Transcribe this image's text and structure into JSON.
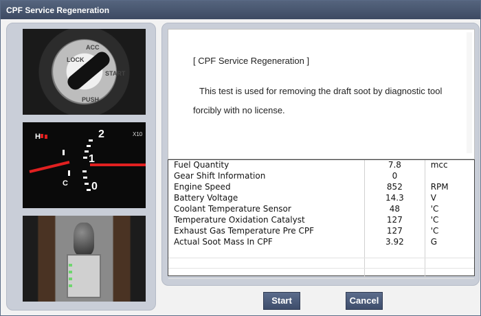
{
  "window": {
    "title": "CPF Service Regeneration"
  },
  "images": {
    "ignition": {
      "labels": [
        "LOCK",
        "ACC",
        "START",
        "PUSH"
      ]
    },
    "gauge": {
      "labels": [
        "H",
        "C",
        "2",
        "1",
        "0",
        "X10"
      ]
    }
  },
  "description": {
    "title": "[ CPF Service Regeneration ]",
    "line1": "This test is used for removing the draft soot by diagnostic tool",
    "line2": "forcibly with no license."
  },
  "table": {
    "rows": [
      {
        "name": "Fuel Quantity",
        "value": "7.8",
        "unit": "mcc"
      },
      {
        "name": "Gear Shift Information",
        "value": "0",
        "unit": ""
      },
      {
        "name": "Engine Speed",
        "value": "852",
        "unit": "RPM"
      },
      {
        "name": "Battery Voltage",
        "value": "14.3",
        "unit": "V"
      },
      {
        "name": "Coolant Temperature Sensor",
        "value": "48",
        "unit": "'C"
      },
      {
        "name": "Temperature Oxidation Catalyst",
        "value": "127",
        "unit": "'C"
      },
      {
        "name": "Exhaust Gas Temperature Pre CPF",
        "value": "127",
        "unit": "'C"
      },
      {
        "name": "Actual Soot Mass In CPF",
        "value": "3.92",
        "unit": "G"
      }
    ]
  },
  "buttons": {
    "start": "Start",
    "cancel": "Cancel"
  },
  "colors": {
    "titlebar": "#4a5771",
    "button": "#4a5a7a",
    "panel": "#c9ced8"
  }
}
